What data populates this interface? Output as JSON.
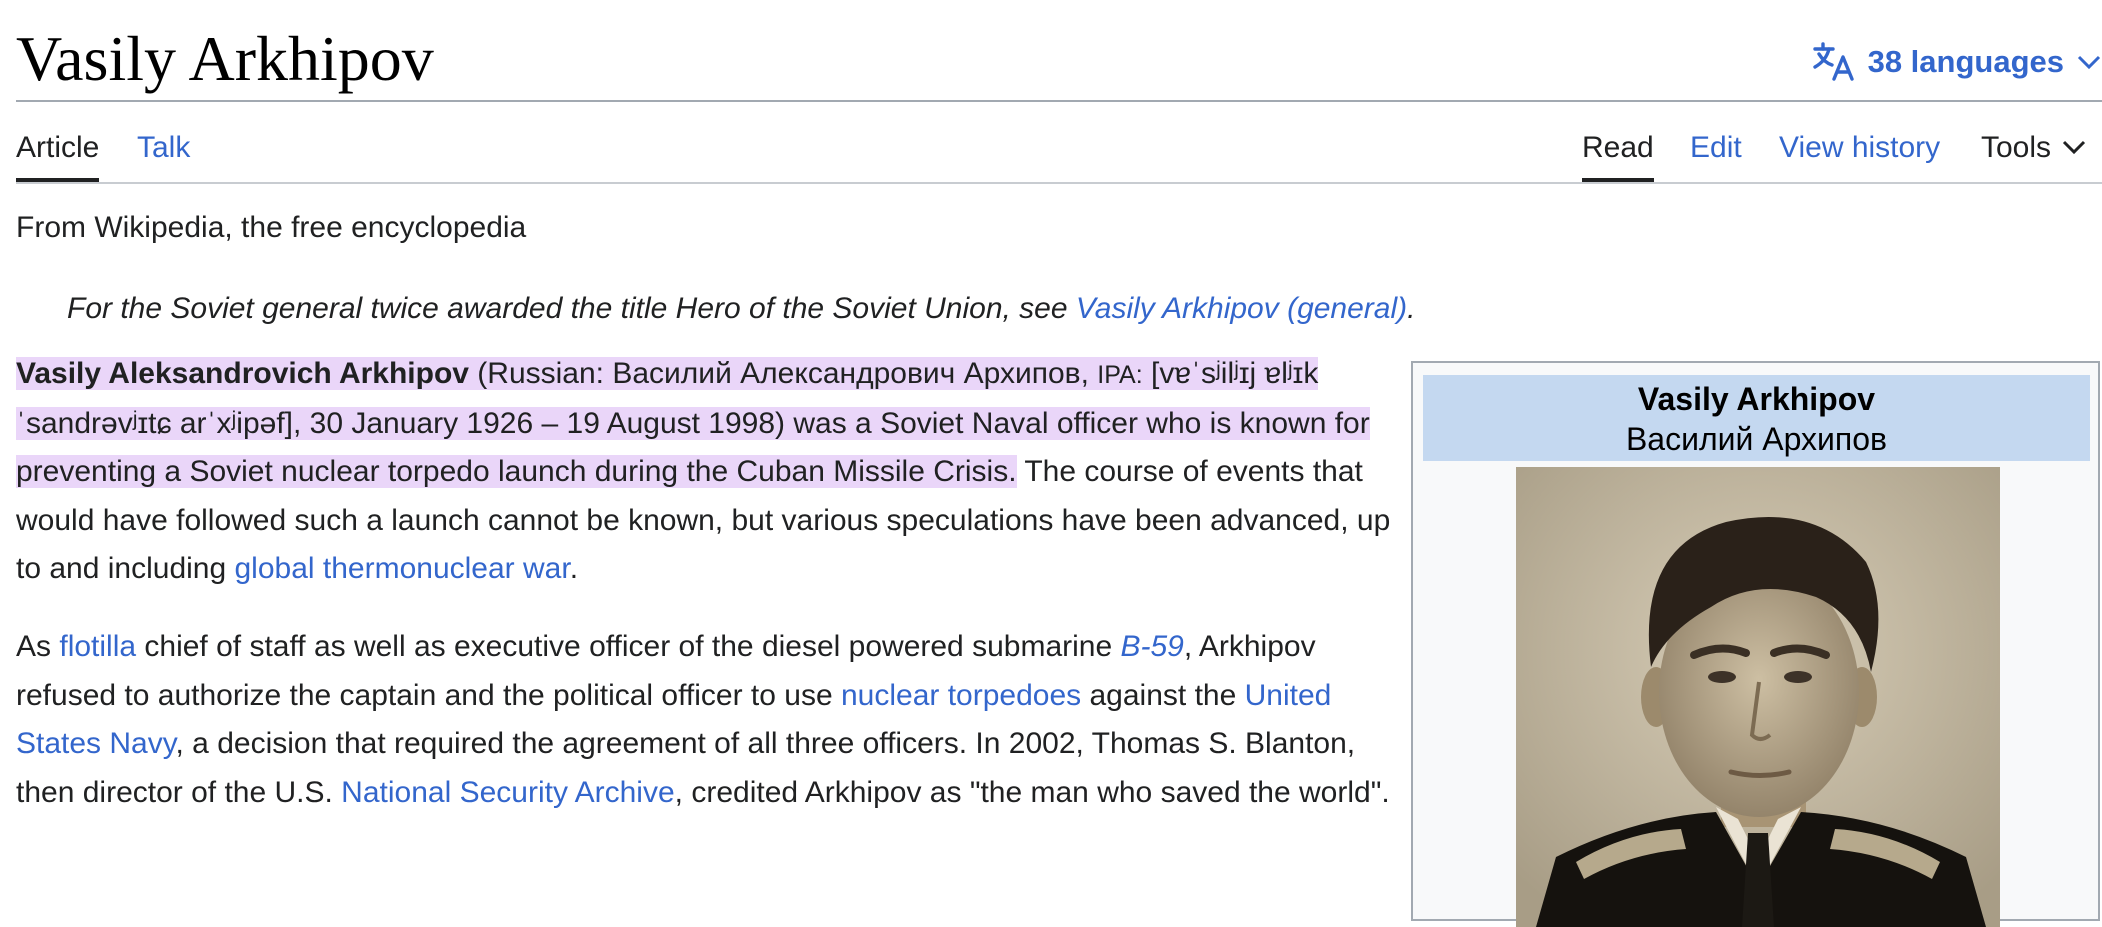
{
  "page": {
    "title": "Vasily Arkhipov",
    "languages_label": "38 languages",
    "tagline": "From Wikipedia, the free encyclopedia"
  },
  "tabs": {
    "article": "Article",
    "talk": "Talk",
    "read": "Read",
    "edit": "Edit",
    "view_history": "View history",
    "tools": "Tools"
  },
  "hatnote": {
    "text": "For the Soviet general twice awarded the title Hero of the Soviet Union, see ",
    "link": "Vasily Arkhipov (general)",
    "end": "."
  },
  "paragraph1": {
    "bold_name": "Vasily Aleksandrovich Arkhipov",
    "t1": " (Russian: Василий Александрович Архипов, ",
    "ipa_label": "IPA:",
    "t2": " [vɐˈsʲilʲɪj ɐlʲɪkˈsandrəvʲɪtɕ arˈxʲipəf], 30 January 1926 – 19 August 1998) was a Soviet Naval officer who is known for preventing a Soviet nuclear torpedo launch during the Cuban Missile Crisis.",
    "t3": " The course of events that would have followed such a launch cannot be known, but various speculations have been advanced, up to and including ",
    "link_war": "global thermonuclear war",
    "t4": "."
  },
  "paragraph2": {
    "t1": "As ",
    "link_flotilla": "flotilla",
    "t2": " chief of staff as well as executive officer of the diesel powered submarine ",
    "link_b59": "B-59",
    "t3": ", Arkhipov refused to authorize the captain and the political officer to use ",
    "link_torpedoes": "nuclear torpedoes",
    "t4": " against the ",
    "link_navy": "United States Navy",
    "t5": ", a decision that required the agreement of all three officers. In 2002, Thomas S. Blanton, then director of the U.S. ",
    "link_nsa": "National Security Archive",
    "t6": ", credited Arkhipov as \"the man who saved the world\"."
  },
  "infobox": {
    "name": "Vasily Arkhipov",
    "native_name": "Василий Архипов"
  },
  "colors": {
    "link": "#3366cc",
    "highlight": "#ead6f9",
    "infobox_header": "#c4d8f0"
  },
  "icons": {
    "languages": "translate-icon",
    "languages_chevron": "chevron-down-icon",
    "tools_chevron": "chevron-down-icon"
  }
}
